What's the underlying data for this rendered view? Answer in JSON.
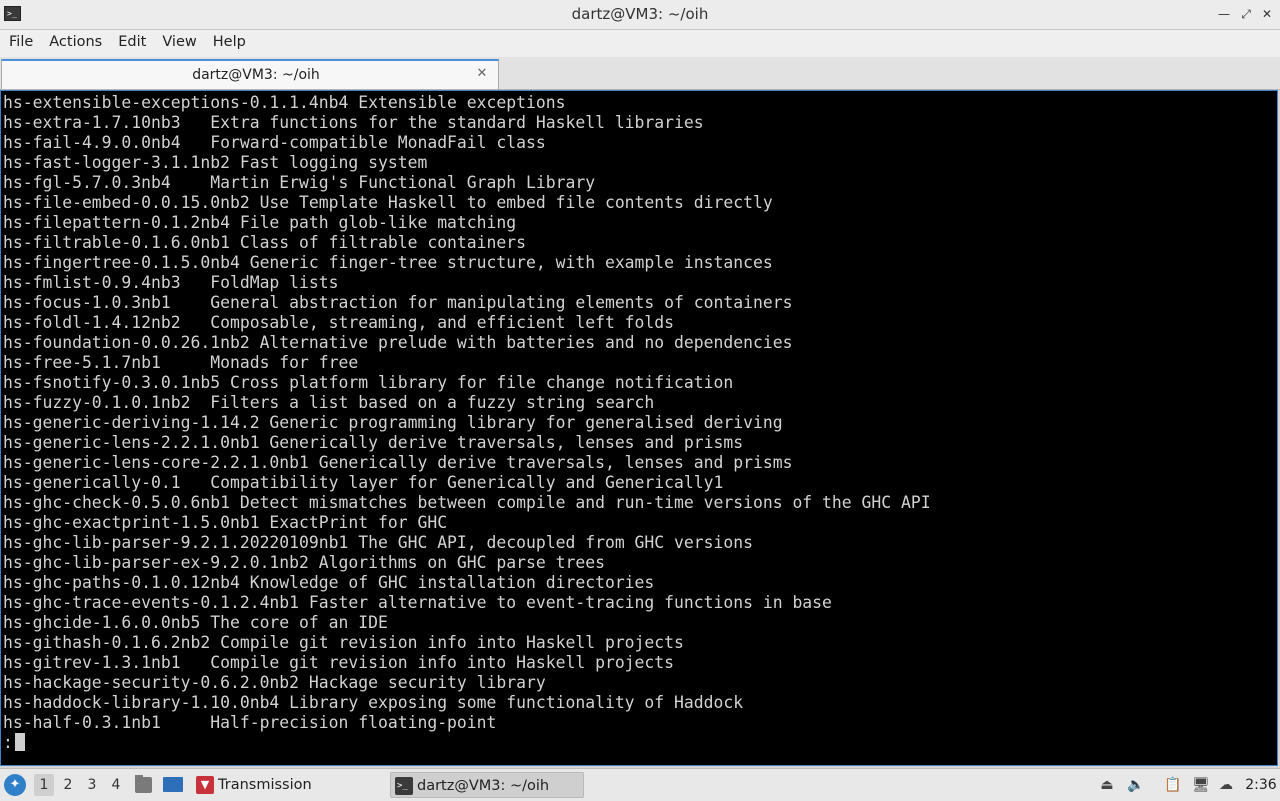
{
  "window": {
    "title": "dartz@VM3: ~/oih",
    "minimize_glyph": "—",
    "maximize_glyph": "⤢",
    "close_glyph": "✕"
  },
  "menu": [
    "File",
    "Actions",
    "Edit",
    "View",
    "Help"
  ],
  "tab": {
    "label": "dartz@VM3: ~/oih",
    "close_glyph": "✕"
  },
  "terminal": {
    "lines": [
      "hs-extensible-exceptions-0.1.1.4nb4 Extensible exceptions",
      "hs-extra-1.7.10nb3   Extra functions for the standard Haskell libraries",
      "hs-fail-4.9.0.0nb4   Forward-compatible MonadFail class",
      "hs-fast-logger-3.1.1nb2 Fast logging system",
      "hs-fgl-5.7.0.3nb4    Martin Erwig's Functional Graph Library",
      "hs-file-embed-0.0.15.0nb2 Use Template Haskell to embed file contents directly",
      "hs-filepattern-0.1.2nb4 File path glob-like matching",
      "hs-filtrable-0.1.6.0nb1 Class of filtrable containers",
      "hs-fingertree-0.1.5.0nb4 Generic finger-tree structure, with example instances",
      "hs-fmlist-0.9.4nb3   FoldMap lists",
      "hs-focus-1.0.3nb1    General abstraction for manipulating elements of containers",
      "hs-foldl-1.4.12nb2   Composable, streaming, and efficient left folds",
      "hs-foundation-0.0.26.1nb2 Alternative prelude with batteries and no dependencies",
      "hs-free-5.1.7nb1     Monads for free",
      "hs-fsnotify-0.3.0.1nb5 Cross platform library for file change notification",
      "hs-fuzzy-0.1.0.1nb2  Filters a list based on a fuzzy string search",
      "hs-generic-deriving-1.14.2 Generic programming library for generalised deriving",
      "hs-generic-lens-2.2.1.0nb1 Generically derive traversals, lenses and prisms",
      "hs-generic-lens-core-2.2.1.0nb1 Generically derive traversals, lenses and prisms",
      "hs-generically-0.1   Compatibility layer for Generically and Generically1",
      "hs-ghc-check-0.5.0.6nb1 Detect mismatches between compile and run-time versions of the GHC API",
      "hs-ghc-exactprint-1.5.0nb1 ExactPrint for GHC",
      "hs-ghc-lib-parser-9.2.1.20220109nb1 The GHC API, decoupled from GHC versions",
      "hs-ghc-lib-parser-ex-9.2.0.1nb2 Algorithms on GHC parse trees",
      "hs-ghc-paths-0.1.0.12nb4 Knowledge of GHC installation directories",
      "hs-ghc-trace-events-0.1.2.4nb1 Faster alternative to event-tracing functions in base",
      "hs-ghcide-1.6.0.0nb5 The core of an IDE",
      "hs-githash-0.1.6.2nb2 Compile git revision info into Haskell projects",
      "hs-gitrev-1.3.1nb1   Compile git revision info into Haskell projects",
      "hs-hackage-security-0.6.2.0nb2 Hackage security library",
      "hs-haddock-library-1.10.0nb4 Library exposing some functionality of Haddock",
      "hs-half-0.3.1nb1     Half-precision floating-point"
    ],
    "prompt": ":"
  },
  "taskbar": {
    "desktops": [
      "1",
      "2",
      "3",
      "4"
    ],
    "active_desktop": "1",
    "tasks": [
      {
        "label": "Transmission",
        "icon": "transmission-icon"
      },
      {
        "label": "dartz@VM3: ~/oih",
        "icon": "terminal-icon"
      }
    ],
    "tray_icons": [
      "eject-icon",
      "volume-icon",
      "clipboard-icon",
      "network-icon",
      "updates-icon"
    ],
    "clock": "2:36"
  }
}
